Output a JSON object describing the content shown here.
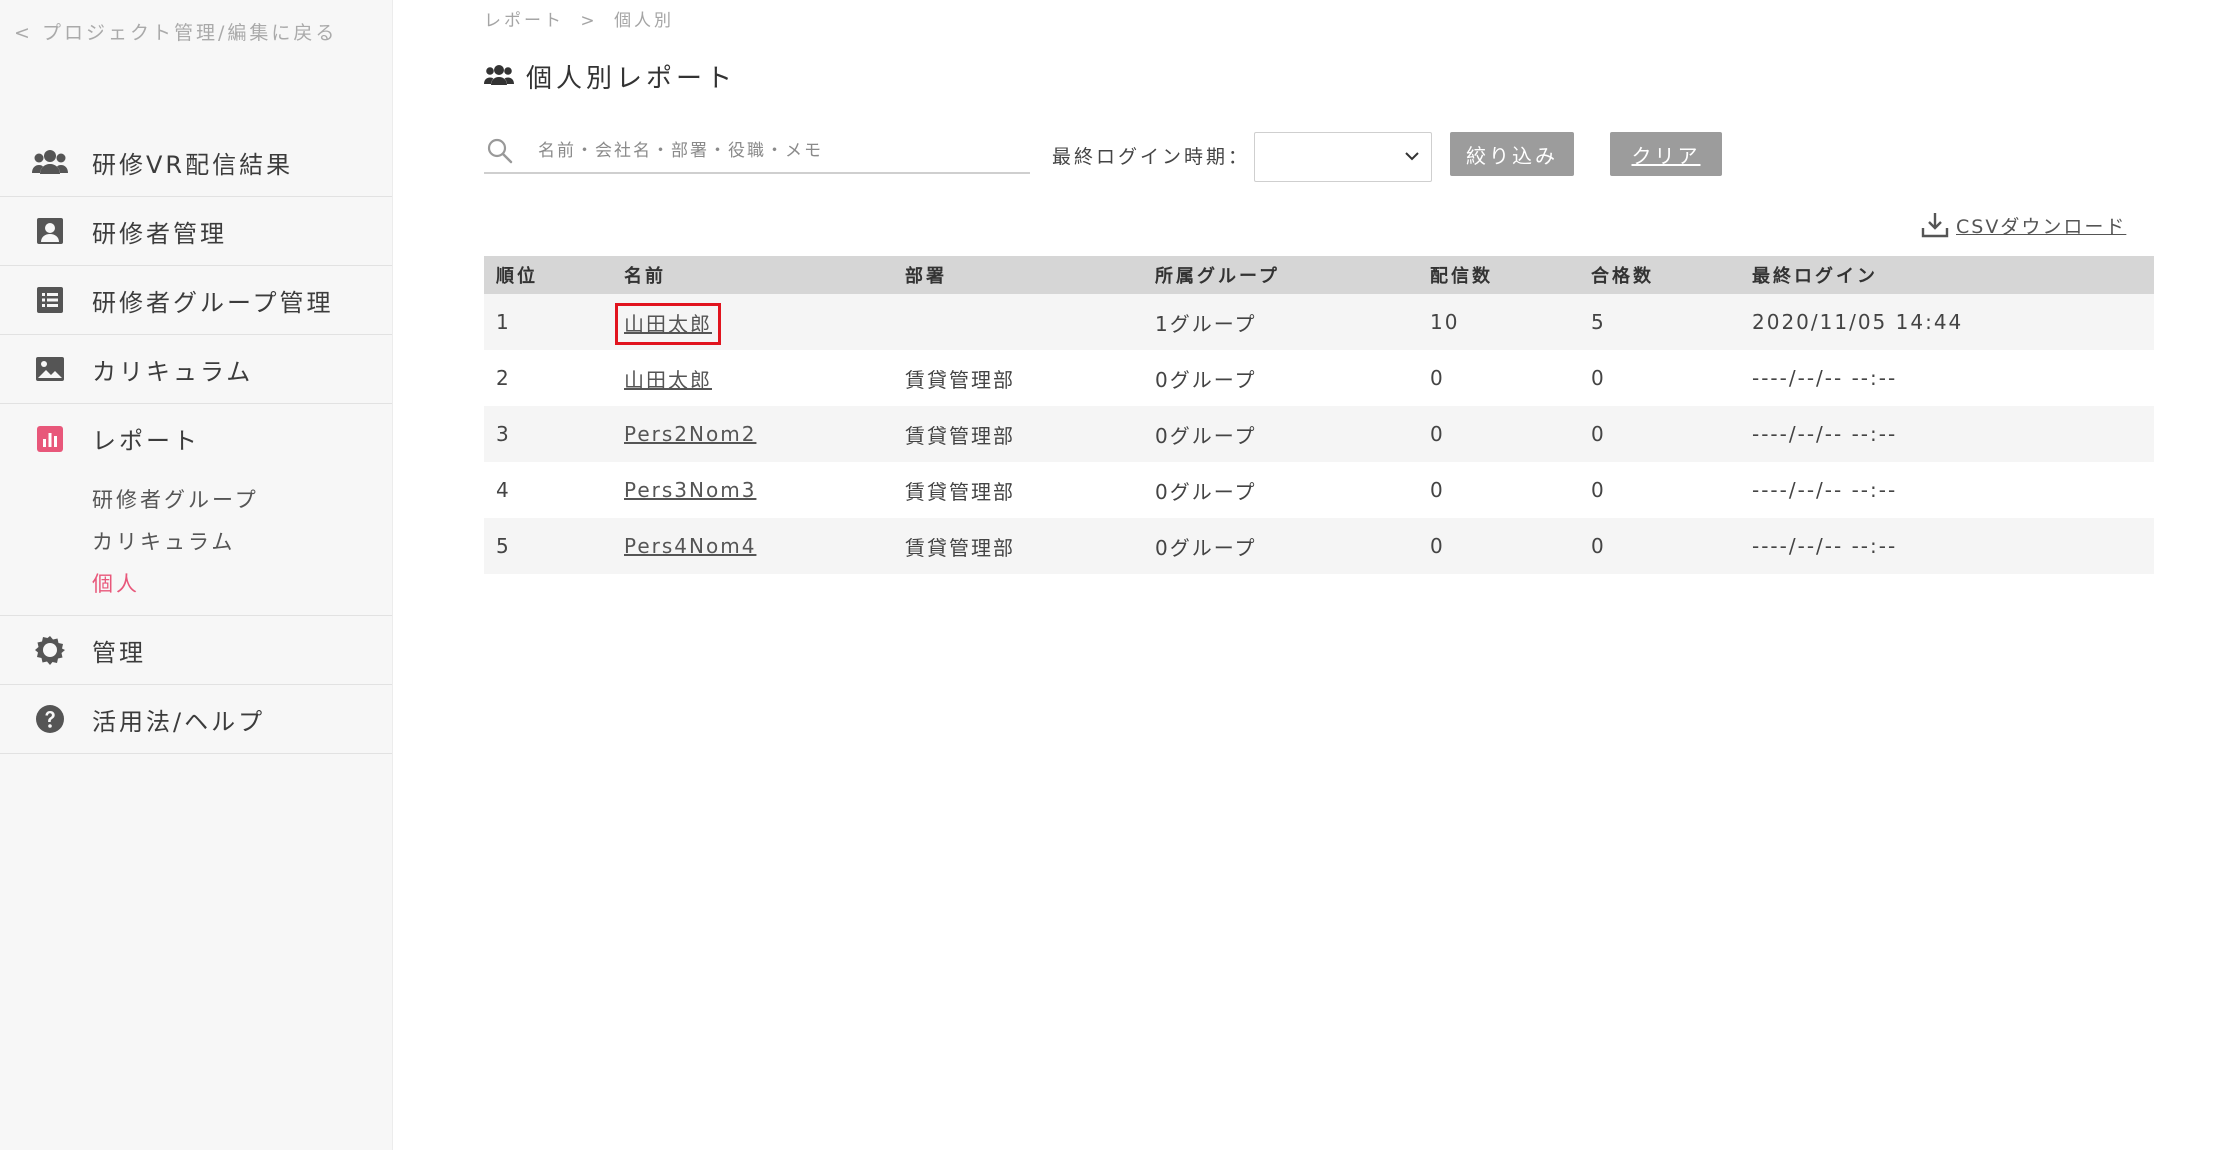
{
  "sidebar": {
    "back_link": "< プロジェクト管理/編集に戻る",
    "items": [
      {
        "label": "研修VR配信結果",
        "icon": "users-icon"
      },
      {
        "label": "研修者管理",
        "icon": "person-card-icon"
      },
      {
        "label": "研修者グループ管理",
        "icon": "list-icon"
      },
      {
        "label": "カリキュラム",
        "icon": "image-icon"
      },
      {
        "label": "レポート",
        "icon": "bar-chart-icon",
        "active_color": "#e8577a"
      },
      {
        "label": "管理",
        "icon": "gear-icon"
      },
      {
        "label": "活用法/ヘルプ",
        "icon": "help-icon"
      }
    ],
    "report_sub_items": [
      {
        "label": "研修者グループ"
      },
      {
        "label": "カリキュラム"
      },
      {
        "label": "個人",
        "active": true
      }
    ]
  },
  "breadcrumb": {
    "parent": "レポート",
    "separator": ">",
    "current": "個人別"
  },
  "page": {
    "title": "個人別レポート"
  },
  "filters": {
    "search_placeholder": "名前・会社名・部署・役職・メモ",
    "search_value": "",
    "last_login_label": "最終ログイン時期：",
    "last_login_selected": "",
    "filter_button": "絞り込み",
    "clear_button": "クリア"
  },
  "csv_download": "CSVダウンロード",
  "table": {
    "headers": [
      "順位",
      "名前",
      "部署",
      "所属グループ",
      "配信数",
      "合格数",
      "最終ログイン"
    ],
    "rows": [
      {
        "rank": "1",
        "name": "山田太郎",
        "dept": "",
        "group": "1グループ",
        "deliveries": "10",
        "passed": "5",
        "last_login": "2020/11/05 14:44"
      },
      {
        "rank": "2",
        "name": "山田太郎",
        "dept": "賃貸管理部",
        "group": "0グループ",
        "deliveries": "0",
        "passed": "0",
        "last_login": "----/--/-- --:--"
      },
      {
        "rank": "3",
        "name": "Pers2Nom2",
        "dept": "賃貸管理部",
        "group": "0グループ",
        "deliveries": "0",
        "passed": "0",
        "last_login": "----/--/-- --:--"
      },
      {
        "rank": "4",
        "name": "Pers3Nom3",
        "dept": "賃貸管理部",
        "group": "0グループ",
        "deliveries": "0",
        "passed": "0",
        "last_login": "----/--/-- --:--"
      },
      {
        "rank": "5",
        "name": "Pers4Nom4",
        "dept": "賃貸管理部",
        "group": "0グループ",
        "deliveries": "0",
        "passed": "0",
        "last_login": "----/--/-- --:--"
      }
    ]
  },
  "colors": {
    "accent_pink": "#e8577a",
    "highlight_red": "#e1141e",
    "button_gray": "#9c9c9c",
    "table_header_bg": "#d6d6d6"
  }
}
